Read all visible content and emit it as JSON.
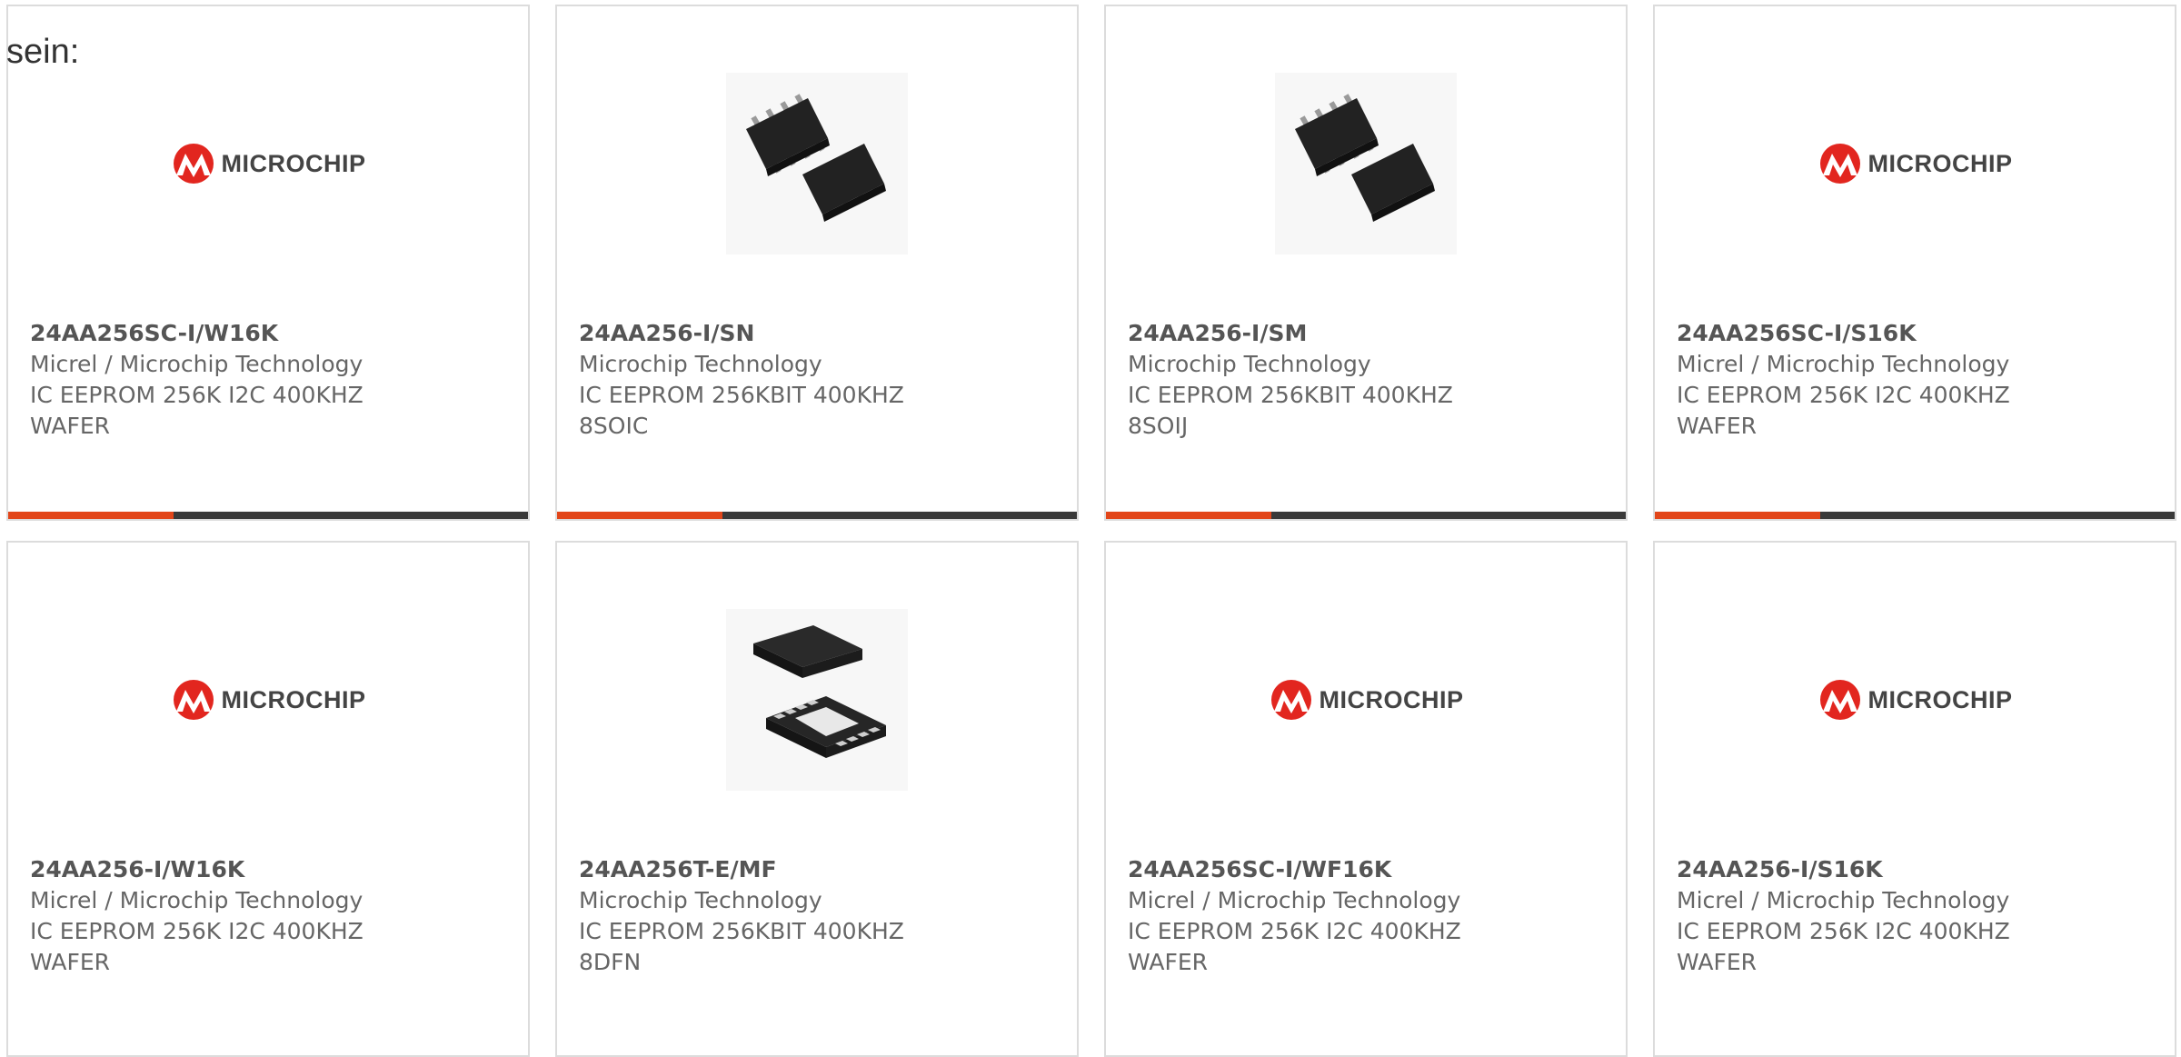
{
  "intro_text": "sein:",
  "colors": {
    "accent": "#e2461a",
    "bar": "#3a3a3a",
    "logo_red": "#e2261f",
    "border": "#dcdcdc"
  },
  "products": [
    {
      "part_number": "24AA256SC-I/W16K",
      "manufacturer": "Micrel / Microchip Technology",
      "description": "IC EEPROM 256K I2C 400KHZ WAFER",
      "image": "microchip-logo",
      "logo_text": "MICROCHIP"
    },
    {
      "part_number": "24AA256-I/SN",
      "manufacturer": "Microchip Technology",
      "description": "IC EEPROM 256KBIT 400KHZ 8SOIC",
      "image": "soic-chip-photo"
    },
    {
      "part_number": "24AA256-I/SM",
      "manufacturer": "Microchip Technology",
      "description": "IC EEPROM 256KBIT 400KHZ 8SOIJ",
      "image": "soic-chip-photo"
    },
    {
      "part_number": "24AA256SC-I/S16K",
      "manufacturer": "Micrel / Microchip Technology",
      "description": "IC EEPROM 256K I2C 400KHZ WAFER",
      "image": "microchip-logo",
      "logo_text": "MICROCHIP"
    },
    {
      "part_number": "24AA256-I/W16K",
      "manufacturer": "Micrel / Microchip Technology",
      "description": "IC EEPROM 256K I2C 400KHZ WAFER",
      "image": "microchip-logo",
      "logo_text": "MICROCHIP"
    },
    {
      "part_number": "24AA256T-E/MF",
      "manufacturer": "Microchip Technology",
      "description": "IC EEPROM 256KBIT 400KHZ 8DFN",
      "image": "dfn-chip-photo"
    },
    {
      "part_number": "24AA256SC-I/WF16K",
      "manufacturer": "Micrel / Microchip Technology",
      "description": "IC EEPROM 256K I2C 400KHZ WAFER",
      "image": "microchip-logo",
      "logo_text": "MICROCHIP"
    },
    {
      "part_number": "24AA256-I/S16K",
      "manufacturer": "Micrel / Microchip Technology",
      "description": "IC EEPROM 256K I2C 400KHZ WAFER",
      "image": "microchip-logo",
      "logo_text": "MICROCHIP"
    }
  ]
}
